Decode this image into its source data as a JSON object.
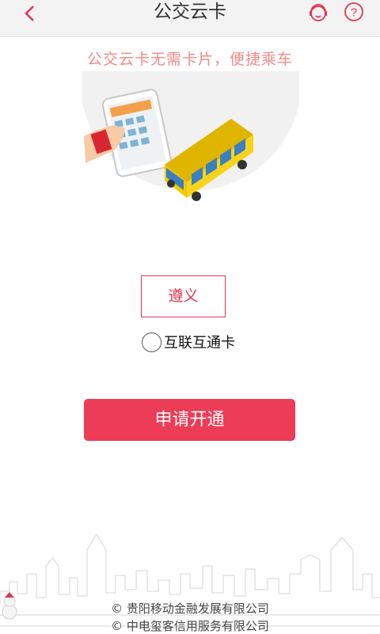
{
  "header": {
    "title": "公交云卡",
    "back_icon": "chevron-left-icon",
    "service_icon": "customer-service-icon",
    "help_icon": "question-circle-icon"
  },
  "tagline": "公交云卡无需卡片，便捷乘车",
  "city_button": "遵义",
  "option_label": "互联互通卡",
  "apply_button": "申请开通",
  "footer": {
    "company1": "© 贵阳移动金融发展有限公司",
    "company2": "© 中电玺客信用服务有限公司"
  },
  "colors": {
    "accent": "#ed3c55",
    "tagline": "#f08a8a"
  }
}
